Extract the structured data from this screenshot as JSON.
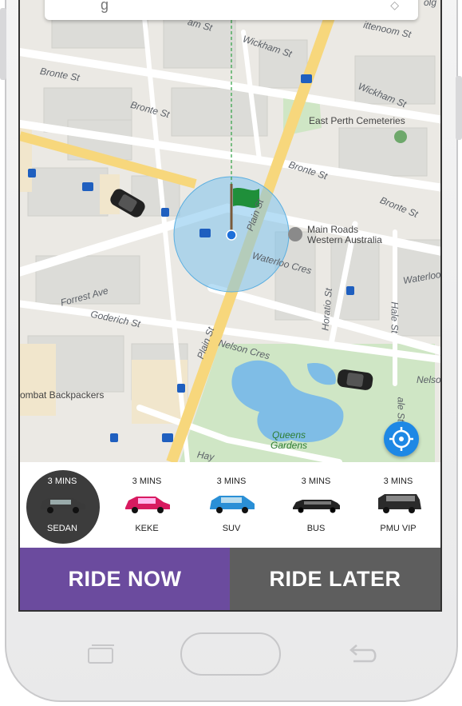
{
  "map": {
    "streets": [
      "Wickham St",
      "Bronte St",
      "Bronte St",
      "Bronte St",
      "Bronte St",
      "Wickham St",
      "Plain St",
      "Plain St",
      "Waterloo Cres",
      "Waterloo",
      "Forrest Ave",
      "Goderich St",
      "Nelson Cres",
      "Nelso",
      "Horatio St",
      "Hale St",
      "ale St",
      "Hay",
      "am St",
      "ittenoom St",
      "olg"
    ],
    "pois": {
      "cemeteries": "East Perth Cemeteries",
      "main_roads_line1": "Main Roads",
      "main_roads_line2": "Western Australia",
      "backpackers": "ombat Backpackers",
      "gardens_line1": "Queens",
      "gardens_line2": "Gardens"
    },
    "route_shields": [
      "65",
      "65",
      "66",
      "65"
    ]
  },
  "top_card": {
    "partial_text": "g"
  },
  "vehicles": [
    {
      "eta": "3 MINS",
      "name": "SEDAN",
      "selected": true,
      "color": "#3a3a3a"
    },
    {
      "eta": "3 MINS",
      "name": "KEKE",
      "selected": false,
      "color": "#d81b60"
    },
    {
      "eta": "3 MINS",
      "name": "SUV",
      "selected": false,
      "color": "#2a8fd6"
    },
    {
      "eta": "3 MINS",
      "name": "BUS",
      "selected": false,
      "color": "#222222"
    },
    {
      "eta": "3 MINS",
      "name": "PMU VIP",
      "selected": false,
      "color": "#2b2b2b"
    }
  ],
  "actions": {
    "ride_now": "RIDE NOW",
    "ride_later": "RIDE LATER"
  },
  "colors": {
    "ride_now_bg": "#6b4b9e",
    "ride_later_bg": "#5e5e5e",
    "locate_bg": "#1e88e5",
    "flag": "#1f8f3a"
  }
}
